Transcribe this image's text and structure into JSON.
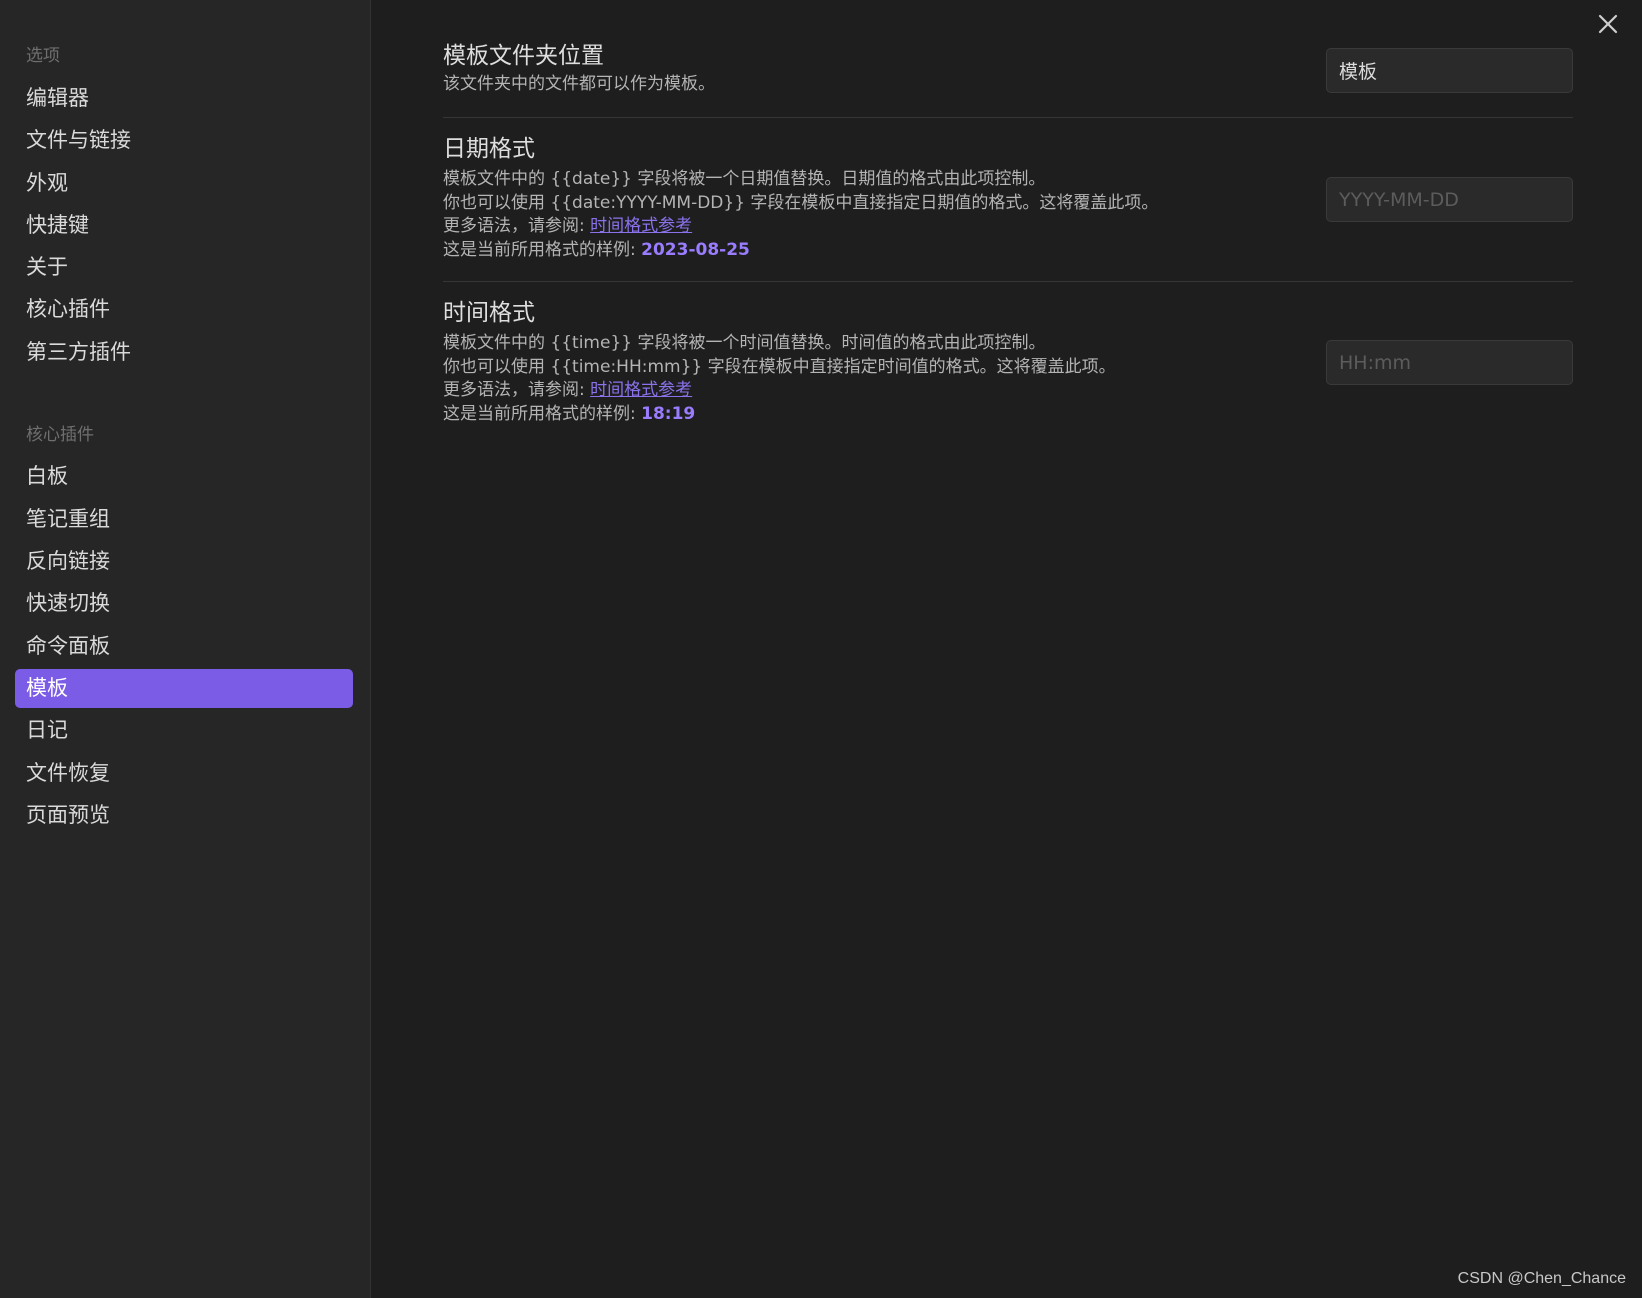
{
  "sidebar": {
    "options_heading": "选项",
    "options_items": [
      "编辑器",
      "文件与链接",
      "外观",
      "快捷键",
      "关于",
      "核心插件",
      "第三方插件"
    ],
    "core_plugins_heading": "核心插件",
    "core_plugins_items": [
      "白板",
      "笔记重组",
      "反向链接",
      "快速切换",
      "命令面板",
      "模板",
      "日记",
      "文件恢复",
      "页面预览"
    ],
    "active_item": "模板"
  },
  "settings": {
    "folder": {
      "title": "模板文件夹位置",
      "desc": "该文件夹中的文件都可以作为模板。",
      "value": "模板"
    },
    "date": {
      "title": "日期格式",
      "desc_line1": "模板文件中的 {{date}} 字段将被一个日期值替换。日期值的格式由此项控制。",
      "desc_line2": "你也可以使用 {{date:YYYY-MM-DD}} 字段在模板中直接指定日期值的格式。这将覆盖此项。",
      "more_prefix": "更多语法，请参阅: ",
      "more_link": "时间格式参考",
      "example_prefix": "这是当前所用格式的样例: ",
      "example_value": "2023-08-25",
      "placeholder": "YYYY-MM-DD"
    },
    "time": {
      "title": "时间格式",
      "desc_line1": "模板文件中的 {{time}} 字段将被一个时间值替换。时间值的格式由此项控制。",
      "desc_line2": "你也可以使用 {{time:HH:mm}} 字段在模板中直接指定时间值的格式。这将覆盖此项。",
      "more_prefix": "更多语法，请参阅: ",
      "more_link": "时间格式参考",
      "example_prefix": "这是当前所用格式的样例: ",
      "example_value": "18:19",
      "placeholder": "HH:mm"
    }
  },
  "watermark": "CSDN @Chen_Chance",
  "icons": {
    "close": "close-icon"
  },
  "colors": {
    "accent": "#7b5ce6",
    "background": "#1e1e1e",
    "sidebar": "#262626"
  }
}
